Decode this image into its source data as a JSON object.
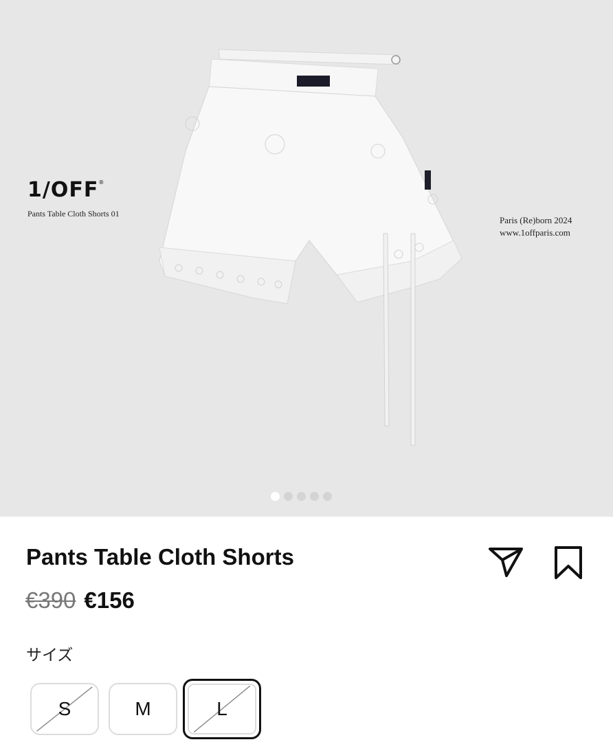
{
  "gallery": {
    "brand_logo": "1/OFF",
    "brand_reg": "®",
    "brand_subtitle": "Pants Table Cloth Shorts 01",
    "caption_line1": "Paris (Re)born 2024",
    "caption_line2": "www.1offparis.com",
    "dots_count": 5,
    "active_dot": 0
  },
  "product": {
    "title": "Pants Table Cloth Shorts",
    "old_price": "€390",
    "new_price": "€156"
  },
  "sizes": {
    "label": "サイズ",
    "options": [
      {
        "label": "S",
        "available": false,
        "selected": false
      },
      {
        "label": "M",
        "available": true,
        "selected": false
      },
      {
        "label": "L",
        "available": false,
        "selected": true
      }
    ]
  },
  "icons": {
    "share": "paper-plane-icon",
    "bookmark": "bookmark-icon"
  }
}
